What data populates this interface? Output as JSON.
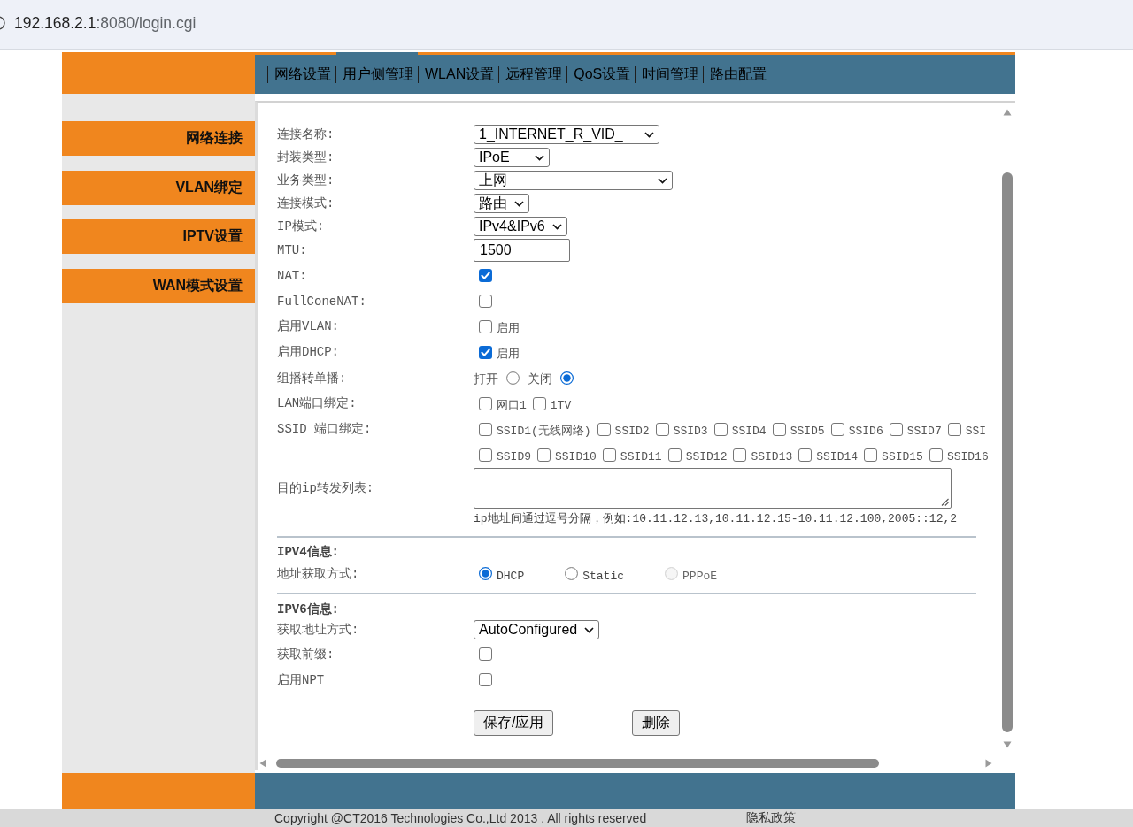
{
  "address_bar": {
    "host": "192.168.2.1",
    "path": ":8080/login.cgi"
  },
  "nav_tabs": [
    {
      "label": "网络设置",
      "selected": false
    },
    {
      "label": "用户侧管理",
      "selected": true
    },
    {
      "label": "WLAN设置",
      "selected": false
    },
    {
      "label": "远程管理",
      "selected": false
    },
    {
      "label": "QoS设置",
      "selected": false
    },
    {
      "label": "时间管理",
      "selected": false
    },
    {
      "label": "路由配置",
      "selected": false
    }
  ],
  "sidebar": {
    "items": [
      "网络连接",
      "VLAN绑定",
      "IPTV设置",
      "WAN模式设置"
    ]
  },
  "form": {
    "rows": [
      {
        "kind": "select",
        "label": "连接名称:",
        "value": "1_INTERNET_R_VID_"
      },
      {
        "kind": "select",
        "label": "封装类型:",
        "value": "IPoE"
      },
      {
        "kind": "select",
        "label": "业务类型:",
        "value": "上网"
      },
      {
        "kind": "select",
        "label": "连接模式:",
        "value": "路由"
      },
      {
        "kind": "select",
        "label": "IP模式:",
        "value": "IPv4&IPv6"
      },
      {
        "kind": "input",
        "label": "MTU:",
        "value": "1500"
      },
      {
        "kind": "check",
        "label": "NAT:",
        "checked": true
      },
      {
        "kind": "check",
        "label": "FullConeNAT:",
        "checked": false
      },
      {
        "kind": "checks",
        "label": "启用VLAN:",
        "options": [
          {
            "label": "启用",
            "checked": false
          }
        ]
      },
      {
        "kind": "checks",
        "label": "启用DHCP:",
        "options": [
          {
            "label": "启用",
            "checked": true
          }
        ]
      },
      {
        "kind": "choice",
        "label": "组播转单播:",
        "options": [
          {
            "label": "打开",
            "selected": false
          },
          {
            "label": "关闭",
            "selected": true
          }
        ]
      },
      {
        "kind": "checks",
        "label": "LAN端口绑定:",
        "options": [
          {
            "label": "网口1",
            "checked": false
          },
          {
            "label": "iTV",
            "checked": false
          }
        ]
      },
      {
        "kind": "checks",
        "label": "SSID 端口绑定:",
        "options": [
          {
            "label": "SSID1(无线网络)",
            "checked": false
          },
          {
            "label": "SSID2",
            "checked": false
          },
          {
            "label": "SSID3",
            "checked": false
          },
          {
            "label": "SSID4",
            "checked": false
          },
          {
            "label": "SSID5",
            "checked": false
          },
          {
            "label": "SSID6",
            "checked": false
          },
          {
            "label": "SSID7",
            "checked": false
          },
          {
            "label": "SSI",
            "checked": false
          },
          {
            "label": "SSID9",
            "checked": false
          },
          {
            "label": "SSID10",
            "checked": false
          },
          {
            "label": "SSID11",
            "checked": false
          },
          {
            "label": "SSID12",
            "checked": false
          },
          {
            "label": "SSID13",
            "checked": false
          },
          {
            "label": "SSID14",
            "checked": false
          },
          {
            "label": "SSID15",
            "checked": false
          },
          {
            "label": "SSID16",
            "checked": false
          }
        ]
      },
      {
        "kind": "textarea",
        "label": "目的ip转发列表:",
        "hint": "ip地址间通过逗号分隔，例如:10.11.12.13,10.11.12.15-10.11.12.100,2005::12,2"
      }
    ]
  },
  "ipv4": {
    "title": "IPV4信息:",
    "rows": [
      {
        "kind": "radio",
        "label": "地址获取方式:",
        "options": [
          {
            "label": "DHCP",
            "selected": true,
            "disabled": false
          },
          {
            "label": "Static",
            "selected": false,
            "disabled": false
          },
          {
            "label": "PPPoE",
            "selected": false,
            "disabled": true
          }
        ]
      }
    ]
  },
  "ipv6": {
    "title": "IPV6信息:",
    "rows": [
      {
        "kind": "select",
        "label": "获取地址方式:",
        "value": "AutoConfigured"
      },
      {
        "kind": "check",
        "label": "获取前缀:",
        "checked": false
      },
      {
        "kind": "check",
        "label": "启用NPT",
        "checked": false
      }
    ]
  },
  "buttons": [
    "保存/应用",
    "删除"
  ],
  "footer": {
    "copyright": "Copyright @CT2016 Technologies Co.,Ltd 2013 . All rights reserved",
    "privacy_link": "隐私政策"
  }
}
